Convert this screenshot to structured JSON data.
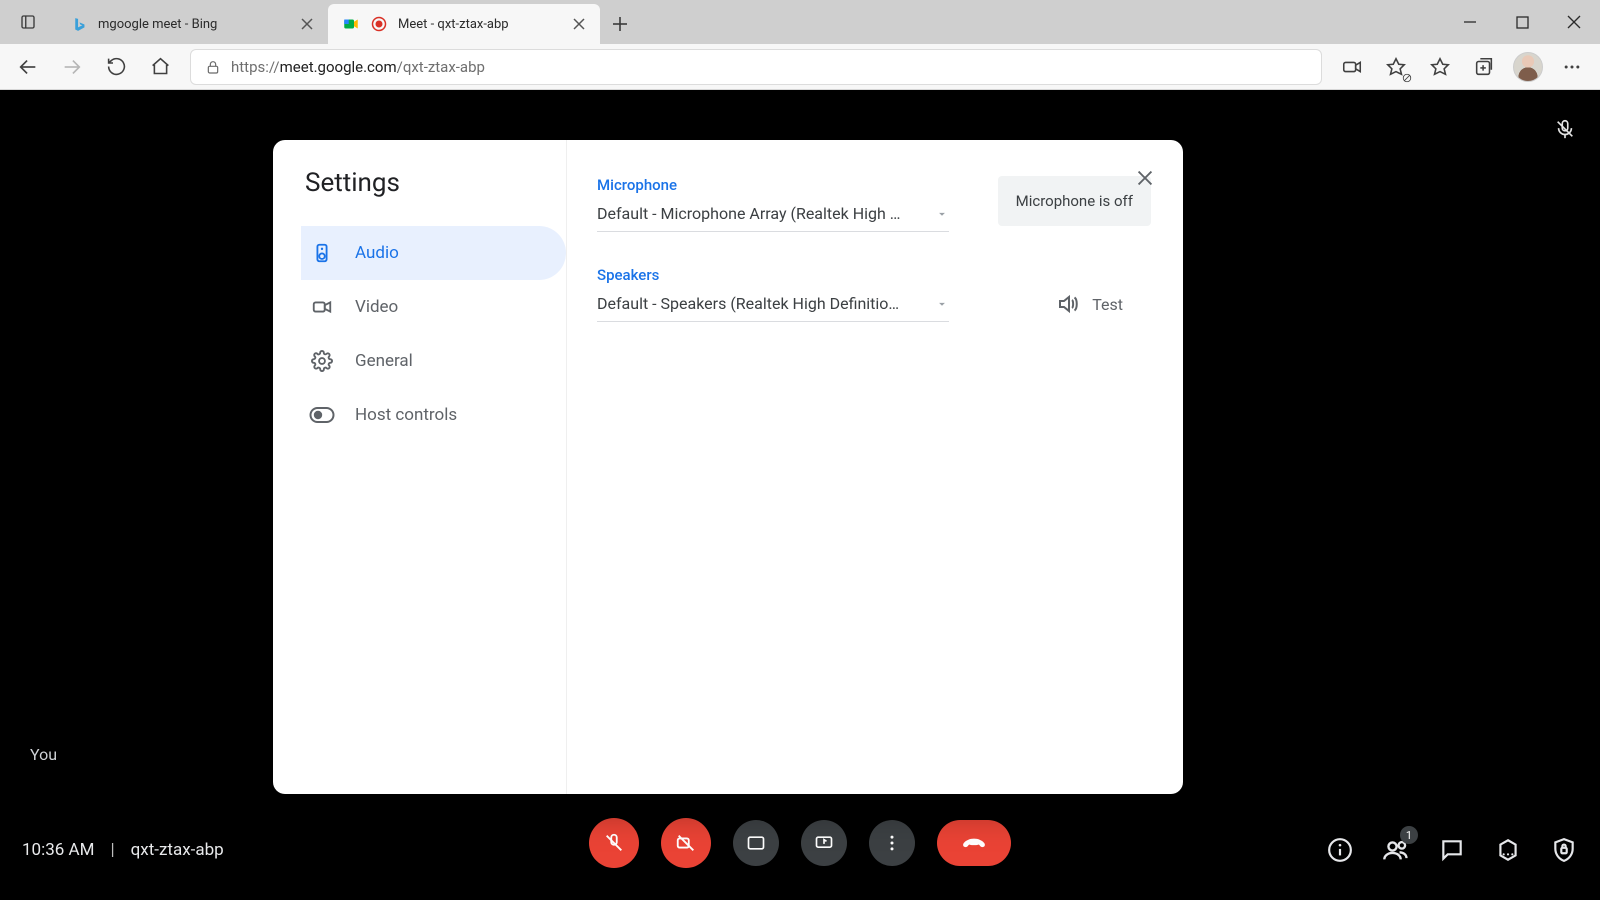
{
  "browser": {
    "tabs": [
      {
        "title": "mgoogle meet - Bing"
      },
      {
        "title": "Meet - qxt-ztax-abp"
      }
    ],
    "url_prefix": "https://",
    "url_host": "meet.google.com",
    "url_path": "/qxt-ztax-abp"
  },
  "page": {
    "self_label": "You",
    "time": "10:36 AM",
    "meeting_code": "qxt-ztax-abp",
    "participants_badge": "1"
  },
  "dialog": {
    "title": "Settings",
    "categories": {
      "audio": "Audio",
      "video": "Video",
      "general": "General",
      "host": "Host controls"
    },
    "microphone": {
      "label": "Microphone",
      "selected": "Default - Microphone Array (Realtek High …",
      "status": "Microphone is off"
    },
    "speakers": {
      "label": "Speakers",
      "selected": "Default - Speakers (Realtek High Definitio…",
      "test_label": "Test"
    }
  }
}
